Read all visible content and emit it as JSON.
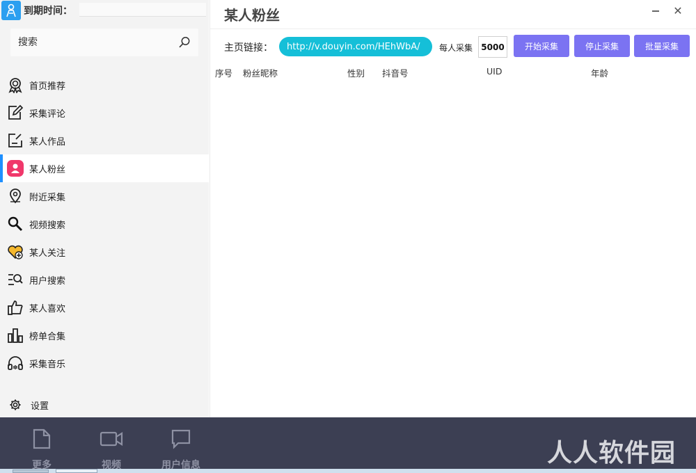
{
  "sidebar": {
    "expiry_label": "到期时间：",
    "search": {
      "placeholder": "搜索"
    },
    "items": [
      {
        "label": "首页推荐",
        "icon": "award-icon"
      },
      {
        "label": "采集评论",
        "icon": "edit-icon"
      },
      {
        "label": "某人作品",
        "icon": "note-icon"
      },
      {
        "label": "某人粉丝",
        "icon": "user-icon",
        "active": true
      },
      {
        "label": "附近采集",
        "icon": "location-pin-icon"
      },
      {
        "label": "视频搜索",
        "icon": "search-icon"
      },
      {
        "label": "某人关注",
        "icon": "heart-add-icon"
      },
      {
        "label": "用户搜索",
        "icon": "list-search-icon"
      },
      {
        "label": "某人喜欢",
        "icon": "thumbs-up-icon"
      },
      {
        "label": "榜单合集",
        "icon": "bar-chart-icon"
      },
      {
        "label": "采集音乐",
        "icon": "headphones-icon"
      }
    ],
    "settings_label": "设置"
  },
  "main": {
    "title": "某人粉丝",
    "url_label": "主页链接：",
    "url_value": "http://v.douyin.com/HEhWbA/",
    "per_label": "每人采集",
    "per_value": "5000",
    "buttons": {
      "start": "开始采集",
      "stop": "停止采集",
      "batch": "批量采集"
    },
    "columns": [
      "序号",
      "粉丝昵称",
      "性别",
      "抖音号",
      "UID",
      "年龄"
    ]
  },
  "bottom": {
    "tabs": [
      "更多",
      "视频",
      "用户信息"
    ],
    "watermark": "人人软件园"
  },
  "colors": {
    "accent": "#1e8fff",
    "url_pill": "#15bfd8",
    "button": "#7b73f2",
    "bottom_bar": "#3c3f53",
    "active_icon": "#f0386b"
  }
}
